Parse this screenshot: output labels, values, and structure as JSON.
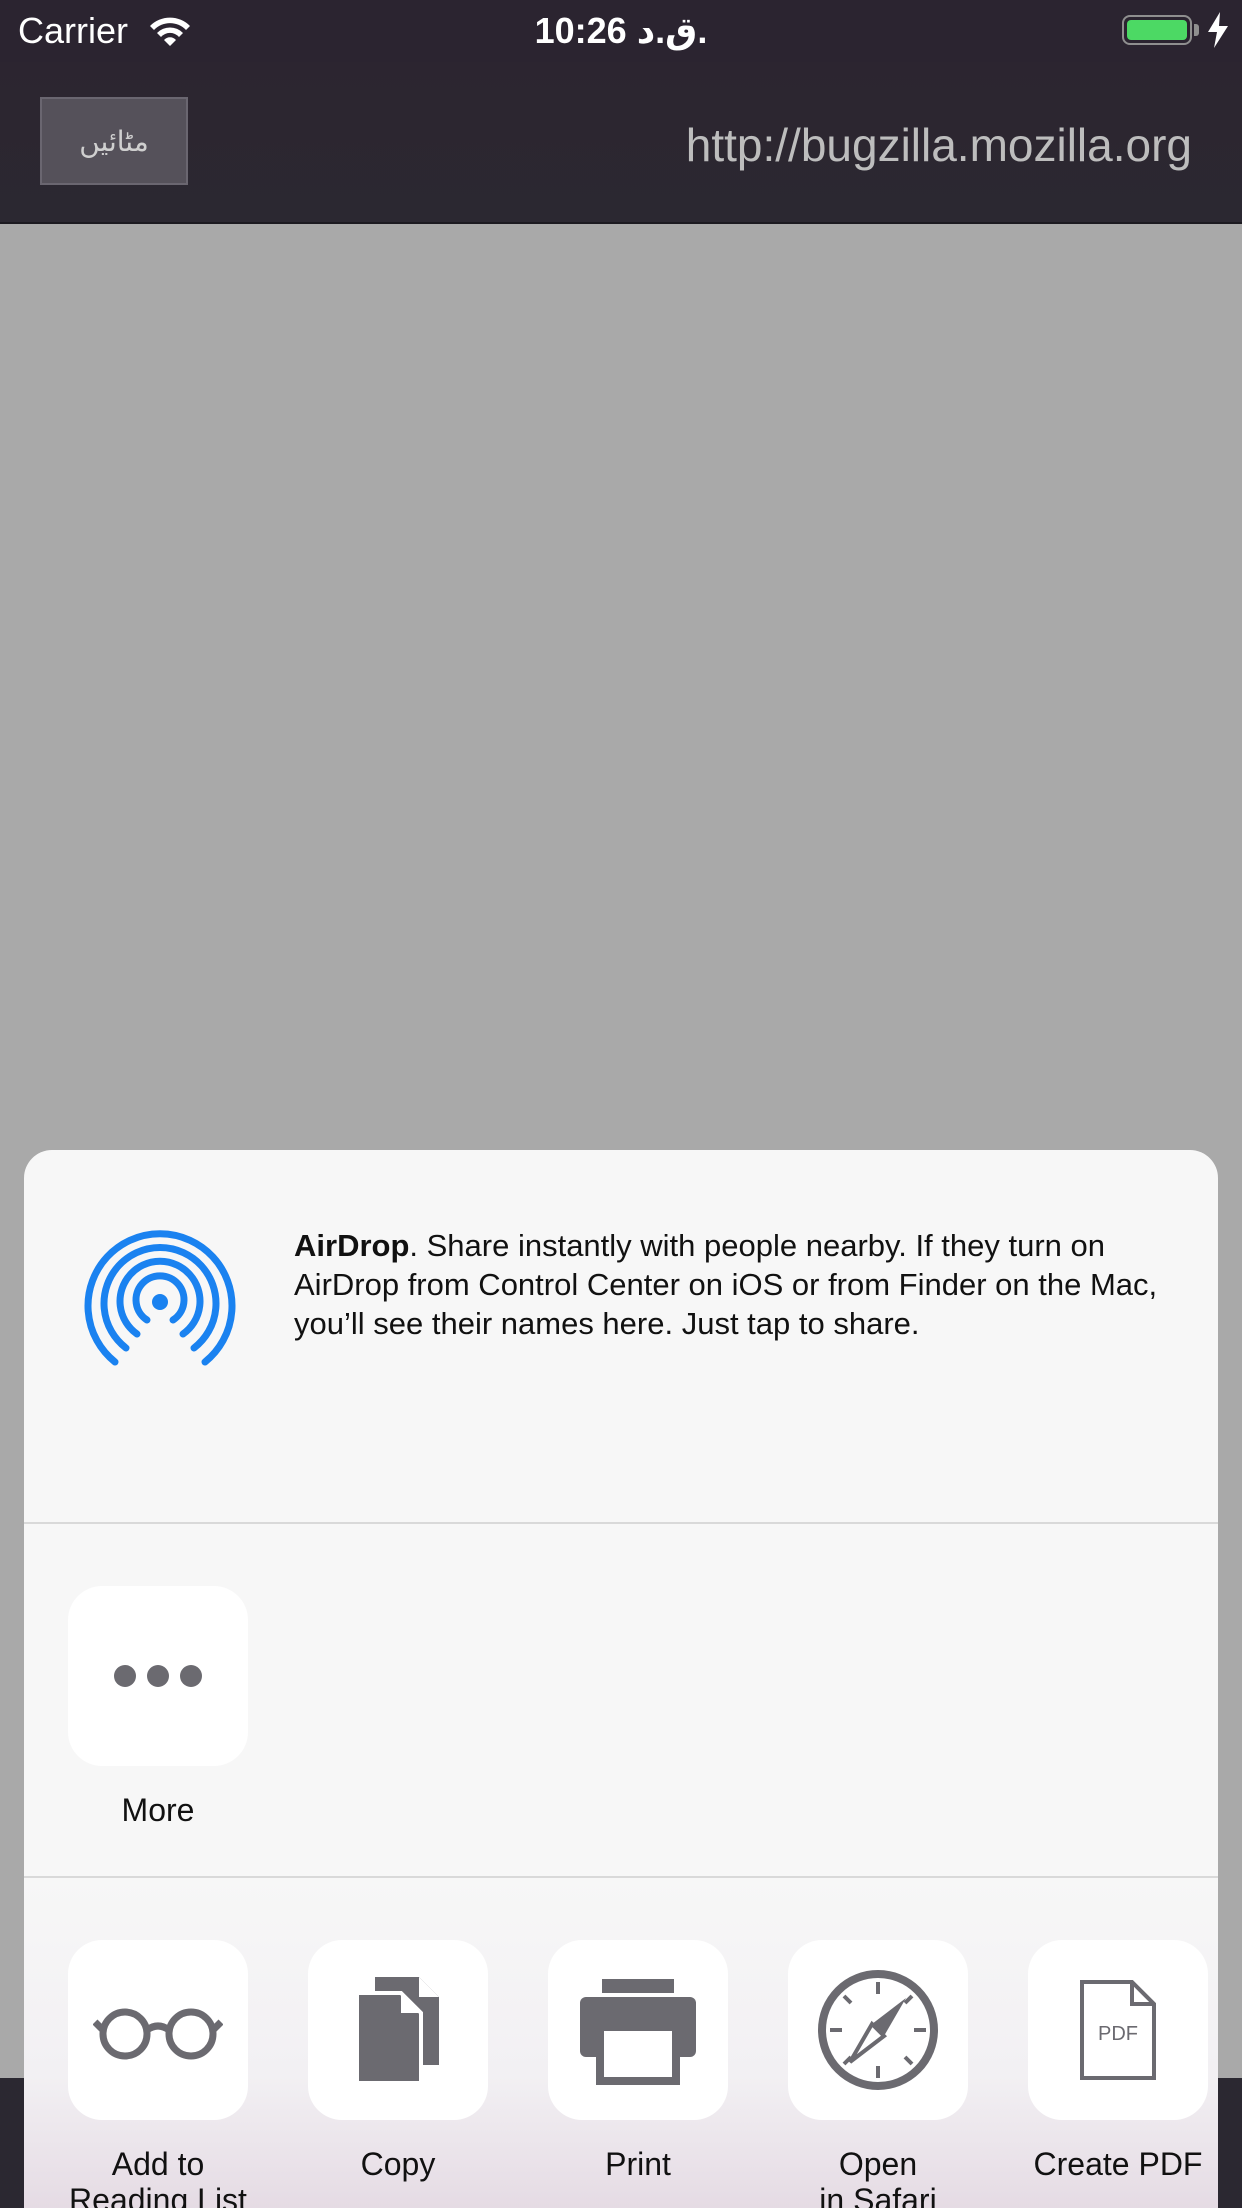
{
  "status_bar": {
    "carrier": "Carrier",
    "time": "10:26 ق.د."
  },
  "nav": {
    "cancel_label": "مٹائیں",
    "url": "http://bugzilla.mozilla.org"
  },
  "share_sheet": {
    "airdrop": {
      "title": "AirDrop",
      "description": ". Share instantly with people nearby. If they turn on AirDrop from Control Center on iOS or from Finder on the Mac, you’ll see their names here. Just tap to share."
    },
    "more_label": "More",
    "actions": [
      {
        "label": "Add to\nReading List",
        "icon": "glasses-icon"
      },
      {
        "label": "Copy",
        "icon": "copy-icon"
      },
      {
        "label": "Print",
        "icon": "printer-icon"
      },
      {
        "label": "Open\nin Safari",
        "icon": "safari-compass-icon"
      },
      {
        "label": "Create PDF",
        "icon": "pdf-icon"
      }
    ]
  },
  "colors": {
    "bar_bg": "#2b2430",
    "battery": "#4cd964",
    "airdrop_blue": "#1a82f0",
    "icon_gray": "#6b6a70"
  }
}
